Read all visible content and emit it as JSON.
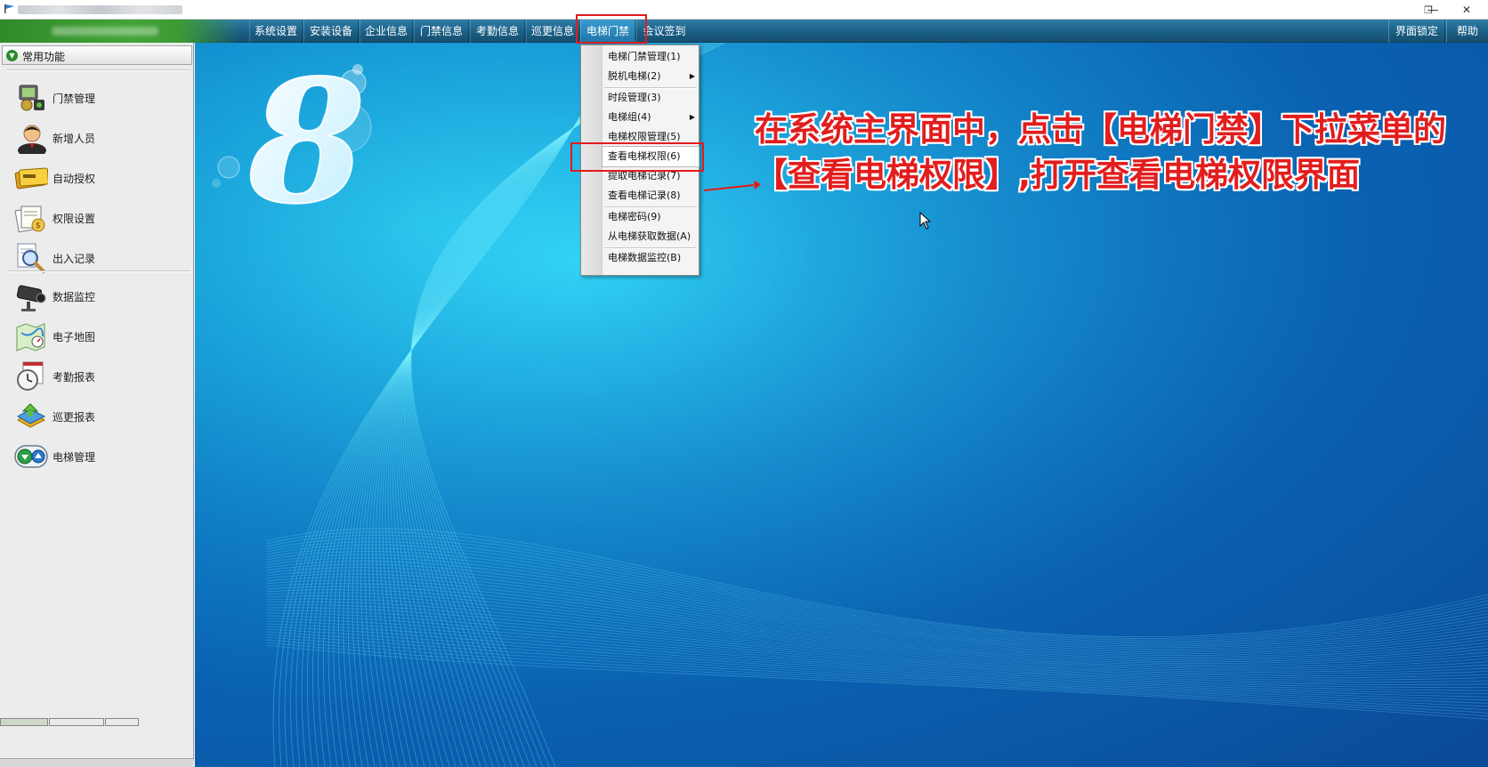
{
  "window": {
    "minimize_glyph": "—",
    "restore_glyph": "❐",
    "close_glyph": "✕"
  },
  "menubar": {
    "items": [
      {
        "label": "系统设置"
      },
      {
        "label": "安装设备"
      },
      {
        "label": "企业信息"
      },
      {
        "label": "门禁信息"
      },
      {
        "label": "考勤信息"
      },
      {
        "label": "巡更信息"
      },
      {
        "label": "电梯门禁"
      },
      {
        "label": "会议签到"
      }
    ],
    "active_item": "电梯门禁",
    "right_items": [
      {
        "label": "界面锁定"
      },
      {
        "label": "帮助"
      }
    ]
  },
  "sidebar": {
    "header": "常用功能",
    "group1": [
      {
        "label": "门禁管理",
        "icon": "access-control-icon"
      },
      {
        "label": "新增人员",
        "icon": "person-icon"
      },
      {
        "label": "自动授权",
        "icon": "card-icon"
      },
      {
        "label": "权限设置",
        "icon": "permission-settings-icon"
      },
      {
        "label": "出入记录",
        "icon": "magnifier-icon"
      }
    ],
    "group2": [
      {
        "label": "数据监控",
        "icon": "camera-icon"
      },
      {
        "label": "电子地图",
        "icon": "map-icon"
      },
      {
        "label": "考勤报表",
        "icon": "clock-icon"
      },
      {
        "label": "巡更报表",
        "icon": "patrol-icon"
      },
      {
        "label": "电梯管理",
        "icon": "elevator-icon"
      }
    ]
  },
  "dropdown": {
    "items": [
      {
        "label": "电梯门禁管理(1)",
        "submenu": false
      },
      {
        "label": "脱机电梯(2)",
        "submenu": true
      },
      {
        "label": "时段管理(3)",
        "submenu": false
      },
      {
        "label": "电梯组(4)",
        "submenu": true
      },
      {
        "label": "电梯权限管理(5)",
        "submenu": false
      },
      {
        "label": "查看电梯权限(6)",
        "submenu": false,
        "highlighted": true
      },
      {
        "label": "提取电梯记录(7)",
        "submenu": false
      },
      {
        "label": "查看电梯记录(8)",
        "submenu": false
      },
      {
        "label": "电梯密码(9)",
        "submenu": false
      },
      {
        "label": "从电梯获取数据(A)",
        "submenu": false
      },
      {
        "label": "电梯数据监控(B)",
        "submenu": false
      }
    ]
  },
  "annotation": {
    "line1": "在系统主界面中，点击【电梯门禁】下拉菜单的",
    "line2": "【查看电梯权限】,打开查看电梯权限界面"
  },
  "colors": {
    "annotation_red": "#e21d1d",
    "menubar_blue": "#1b5f86",
    "brand_green": "#42a436",
    "desktop_blue": "#0c82cc"
  }
}
